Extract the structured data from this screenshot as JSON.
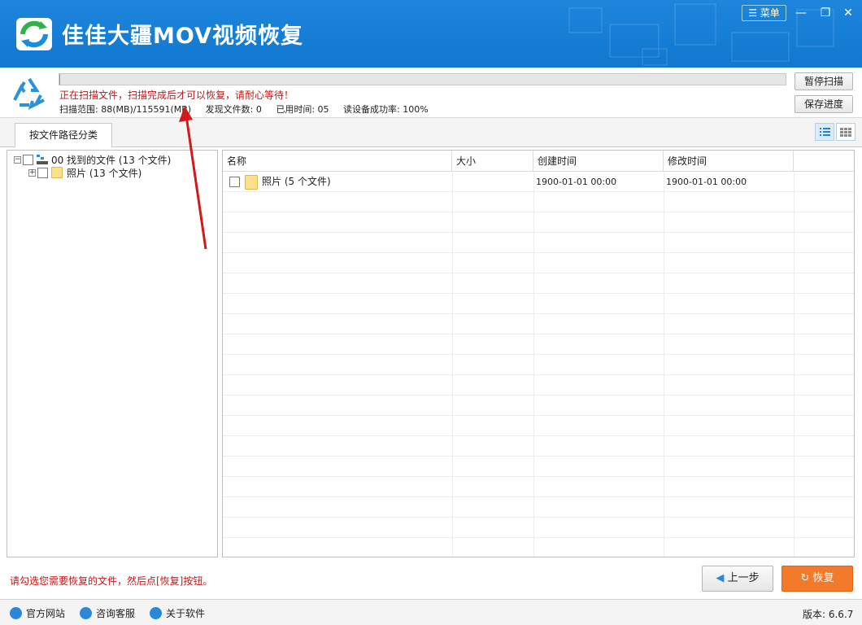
{
  "header": {
    "app_title": "佳佳大疆MOV视频恢复",
    "menu_label": "菜单",
    "minimize": "—",
    "maximize": "❐",
    "close": "✕"
  },
  "scan": {
    "progress_fraction": 0.001,
    "message": "正在扫描文件，扫描完成后才可以恢复，请耐心等待！",
    "range": "扫描范围: 88(MB)/115591(MB)",
    "found": "发现文件数: 0",
    "elapsed": "已用时间: 05",
    "success_rate": "读设备成功率: 100%",
    "pause_label": "暂停扫描",
    "save_label": "保存进度"
  },
  "tabs": {
    "active_label": "按文件路径分类"
  },
  "tree": {
    "root_label": "00 找到的文件 (13 个文件)",
    "child_label": "照片   (13 个文件)"
  },
  "list": {
    "columns": [
      "名称",
      "大小",
      "创建时间",
      "修改时间"
    ],
    "rows": [
      {
        "name": "照片   (5 个文件)",
        "size": "",
        "created": "1900-01-01  00:00",
        "modified": "1900-01-01  00:00"
      }
    ]
  },
  "actions": {
    "hint": "请勾选您需要恢复的文件，然后点[恢复]按钮。",
    "prev_label": "上一步",
    "restore_label": "恢复"
  },
  "footer": {
    "official_site": "官方网站",
    "support": "咨询客服",
    "about": "关于软件",
    "version": "版本: 6.6.7"
  },
  "colors": {
    "title_bar": "#1177cf",
    "accent_red": "#c0171a",
    "restore_orange": "#f37a2a"
  }
}
